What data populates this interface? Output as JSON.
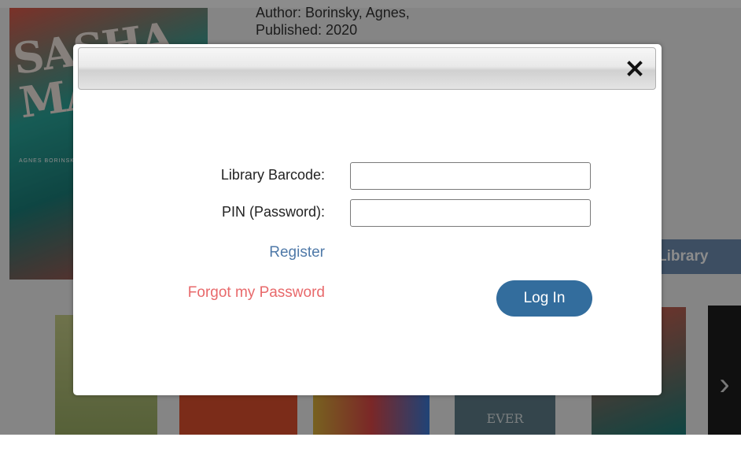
{
  "background": {
    "book_title": "SASHA MASHA",
    "book_author_on_cover": "AGNES BORINSKY",
    "author_line": "Author: Borinsky, Agnes,",
    "published_line": "Published: 2020",
    "library_button_label": "Library",
    "partial_cover_text": "EVER",
    "next_arrow": "›"
  },
  "login_modal": {
    "close_label": "×",
    "barcode_label": "Library Barcode:",
    "barcode_value": "",
    "pin_label": "PIN (Password):",
    "pin_value": "",
    "register_link": "Register",
    "forgot_password_link": "Forgot my Password",
    "login_button": "Log In"
  },
  "colors": {
    "overlay": "#000000",
    "login_button": "#336d9d",
    "register_link": "#4f79a8",
    "forgot_link": "#e8696b"
  }
}
